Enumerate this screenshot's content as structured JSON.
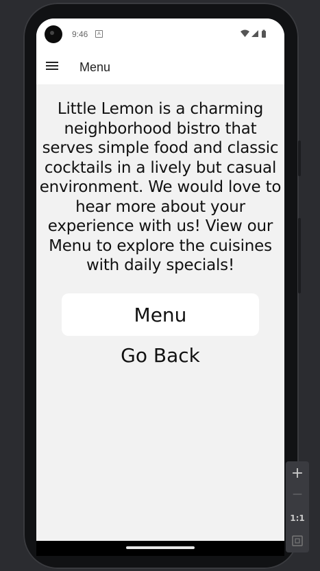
{
  "status_bar": {
    "time": "9:46",
    "notification_glyph": "A",
    "icons": [
      "wifi-icon",
      "signal-icon",
      "battery-icon"
    ]
  },
  "app_bar": {
    "title": "Menu",
    "nav_icon": "hamburger-menu-icon"
  },
  "content": {
    "description": "Little Lemon is a charming neighborhood bistro that serves simple food and classic cocktails in a lively but casual environment. We would love to hear more about your experience with us! View our Menu to explore the cuisines with daily specials!",
    "menu_button_label": "Menu",
    "go_back_label": "Go Back"
  },
  "emulator_zoom": {
    "zoom_in": "+",
    "zoom_out": "—",
    "actual_size": "1:1",
    "fit_icon": "fit-screen-icon"
  },
  "colors": {
    "screen_background": "#f2f2f2",
    "app_bar_background": "#ffffff",
    "button_background": "#ffffff",
    "text": "#111111"
  }
}
